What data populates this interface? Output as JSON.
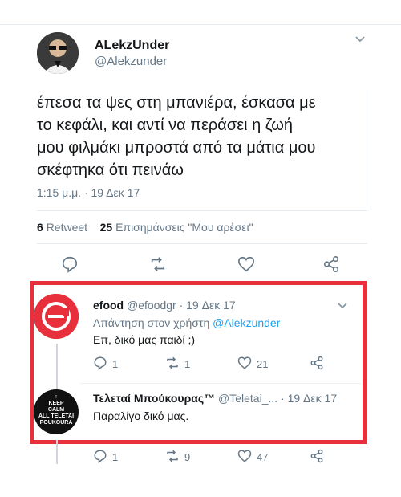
{
  "tweet": {
    "display_name": "ALekzUnder",
    "handle": "@Alekzunder",
    "text_lines": [
      "έπεσα τα ψες στη μπανιέρα, έσκασα με",
      "το κεφάλι, και αντί να περάσει η ζωή",
      "μου φιλμάκι μπροστά από τα μάτια μου",
      "σκέφτηκα ότι πεινάω"
    ],
    "timestamp": "1:15 μ.μ. · 19 Δεκ 17",
    "retweet_count": "6",
    "retweet_label": "Retweet",
    "likes_count": "25",
    "likes_label": "Επισημάνσεις \"Μου αρέσει\""
  },
  "reply1": {
    "display_name": "efood",
    "handle": "@efoodgr",
    "date": "· 19 Δεκ 17",
    "reply_to_prefix": "Απάντηση στον χρήστη",
    "reply_to_user": "@Alekzunder",
    "text": "Επ, δικό μας παιδί ;)",
    "reply_count": "1",
    "retweet_count": "1",
    "like_count": "21"
  },
  "reply2": {
    "display_name": "Τελεταί Μπούκουρας™",
    "handle": "@Teletai_...",
    "date": "· 19 Δεκ 17",
    "text": "Παραλίγο δικό μας.",
    "avatar_lines": [
      "↑",
      "KEEP",
      "CALM",
      "ALL TELETAI",
      "POUKOURA"
    ]
  },
  "footer_actions": {
    "reply_count": "1",
    "retweet_count": "9",
    "like_count": "47"
  },
  "colors": {
    "highlight_border": "#e8303d",
    "link": "#1da1f2",
    "muted": "#657786"
  },
  "icons": [
    "reply-icon",
    "retweet-icon",
    "heart-icon",
    "share-icon",
    "chevron-down-icon"
  ]
}
